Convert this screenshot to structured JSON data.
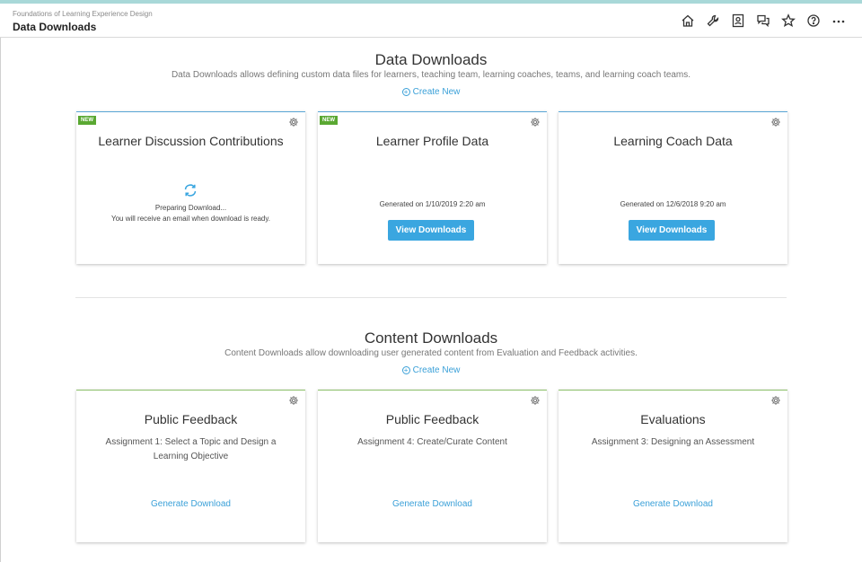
{
  "header": {
    "course": "Foundations of Learning Experience Design",
    "title": "Data Downloads"
  },
  "data_section": {
    "title": "Data Downloads",
    "description": "Data Downloads allows defining custom data files for learners, teaching team, learning coaches, teams, and learning coach teams.",
    "create_new": "Create New",
    "cards": [
      {
        "badge": "NEW",
        "title": "Learner Discussion Contributions",
        "status_line1": "Preparing Download...",
        "status_line2": "You will receive an email when download is ready."
      },
      {
        "badge": "NEW",
        "title": "Learner Profile Data",
        "generated": "Generated on 1/10/2019 2:20 am",
        "button": "View Downloads"
      },
      {
        "title": "Learning Coach Data",
        "generated": "Generated on 12/6/2018 9:20 am",
        "button": "View Downloads"
      }
    ]
  },
  "content_section": {
    "title": "Content Downloads",
    "description": "Content Downloads allow downloading user generated content from Evaluation and Feedback activities.",
    "create_new": "Create New",
    "cards": [
      {
        "title": "Public Feedback",
        "subtitle": "Assignment 1: Select a Topic and Design a Learning Objective",
        "link": "Generate Download"
      },
      {
        "title": "Public Feedback",
        "subtitle": "Assignment 4: Create/Curate Content",
        "link": "Generate Download"
      },
      {
        "title": "Evaluations",
        "subtitle": "Assignment 3: Designing an Assessment",
        "link": "Generate Download"
      }
    ]
  },
  "colors": {
    "accent": "#3aa6e0",
    "badge": "#5aa832",
    "data_card_border": "#5aa6d6",
    "content_card_border": "#8dc06a"
  }
}
